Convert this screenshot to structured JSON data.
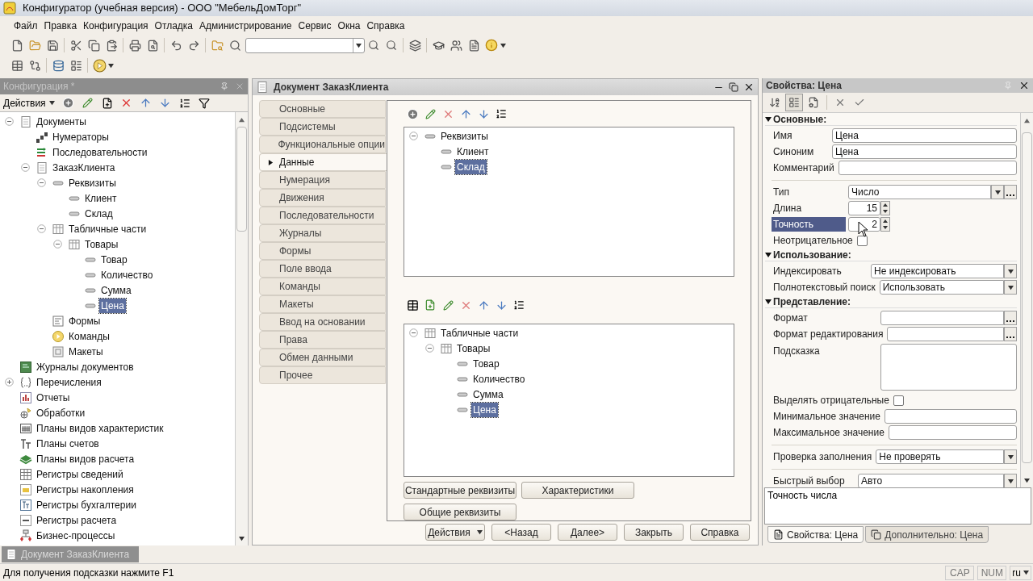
{
  "window": {
    "title": "Конфигуратор (учебная версия) - ООО \"МебельДомТорг\""
  },
  "menu": [
    "Файл",
    "Правка",
    "Конфигурация",
    "Отладка",
    "Администрирование",
    "Сервис",
    "Окна",
    "Справка"
  ],
  "config_panel": {
    "title": "Конфигурация *",
    "actions_label": "Действия",
    "tree": [
      {
        "label": "Документы",
        "kind": "documents",
        "expanded": true,
        "selected": false,
        "children": [
          {
            "label": "Нумераторы",
            "kind": "numerators",
            "selected": false
          },
          {
            "label": "Последовательности",
            "kind": "sequences",
            "selected": false
          },
          {
            "label": "ЗаказКлиента",
            "kind": "document",
            "expanded": true,
            "selected": false,
            "children": [
              {
                "label": "Реквизиты",
                "kind": "attributes",
                "expanded": true,
                "selected": false,
                "children": [
                  {
                    "label": "Клиент",
                    "kind": "attribute",
                    "selected": false
                  },
                  {
                    "label": "Склад",
                    "kind": "attribute",
                    "selected": false
                  }
                ]
              },
              {
                "label": "Табличные части",
                "kind": "tabular-sections",
                "expanded": true,
                "selected": false,
                "children": [
                  {
                    "label": "Товары",
                    "kind": "tabular-section",
                    "expanded": true,
                    "selected": false,
                    "children": [
                      {
                        "label": "Товар",
                        "kind": "attribute",
                        "selected": false
                      },
                      {
                        "label": "Количество",
                        "kind": "attribute",
                        "selected": false
                      },
                      {
                        "label": "Сумма",
                        "kind": "attribute",
                        "selected": false
                      },
                      {
                        "label": "Цена",
                        "kind": "attribute",
                        "selected": true
                      }
                    ]
                  }
                ]
              },
              {
                "label": "Формы",
                "kind": "forms",
                "selected": false
              },
              {
                "label": "Команды",
                "kind": "commands",
                "selected": false
              },
              {
                "label": "Макеты",
                "kind": "templates",
                "selected": false
              }
            ]
          }
        ]
      },
      {
        "label": "Журналы документов",
        "kind": "journals",
        "selected": false
      },
      {
        "label": "Перечисления",
        "kind": "enums",
        "expanded": false,
        "selected": false
      },
      {
        "label": "Отчеты",
        "kind": "reports",
        "selected": false
      },
      {
        "label": "Обработки",
        "kind": "processings",
        "selected": false
      },
      {
        "label": "Планы видов характеристик",
        "kind": "characteristic-plans",
        "selected": false
      },
      {
        "label": "Планы счетов",
        "kind": "account-plans",
        "selected": false
      },
      {
        "label": "Планы видов расчета",
        "kind": "calc-plans",
        "selected": false
      },
      {
        "label": "Регистры сведений",
        "kind": "info-registers",
        "selected": false
      },
      {
        "label": "Регистры накопления",
        "kind": "accum-registers",
        "selected": false
      },
      {
        "label": "Регистры бухгалтерии",
        "kind": "account-registers",
        "selected": false
      },
      {
        "label": "Регистры расчета",
        "kind": "calc-registers",
        "selected": false
      },
      {
        "label": "Бизнес-процессы",
        "kind": "business-processes",
        "selected": false
      }
    ]
  },
  "document_window": {
    "title": "Документ ЗаказКлиента",
    "tabs": [
      {
        "label": "Основные",
        "selected": false
      },
      {
        "label": "Подсистемы",
        "selected": false
      },
      {
        "label": "Функциональные опции",
        "selected": false
      },
      {
        "label": "Данные",
        "selected": true
      },
      {
        "label": "Нумерация",
        "selected": false
      },
      {
        "label": "Движения",
        "selected": false
      },
      {
        "label": "Последовательности",
        "selected": false
      },
      {
        "label": "Журналы",
        "selected": false
      },
      {
        "label": "Формы",
        "selected": false
      },
      {
        "label": "Поле ввода",
        "selected": false
      },
      {
        "label": "Команды",
        "selected": false
      },
      {
        "label": "Макеты",
        "selected": false
      },
      {
        "label": "Ввод на основании",
        "selected": false
      },
      {
        "label": "Права",
        "selected": false
      },
      {
        "label": "Обмен данными",
        "selected": false
      },
      {
        "label": "Прочее",
        "selected": false
      }
    ],
    "attributes_tree": [
      {
        "label": "Реквизиты",
        "kind": "attributes",
        "expanded": true,
        "selected": false,
        "children": [
          {
            "label": "Клиент",
            "kind": "attribute",
            "selected": false
          },
          {
            "label": "Склад",
            "kind": "attribute",
            "selected": true
          }
        ]
      }
    ],
    "tabular_tree": [
      {
        "label": "Табличные части",
        "kind": "tabular-sections",
        "expanded": true,
        "selected": false,
        "children": [
          {
            "label": "Товары",
            "kind": "tabular-section",
            "expanded": true,
            "selected": false,
            "children": [
              {
                "label": "Товар",
                "kind": "attribute",
                "selected": false
              },
              {
                "label": "Количество",
                "kind": "attribute",
                "selected": false
              },
              {
                "label": "Сумма",
                "kind": "attribute",
                "selected": false
              },
              {
                "label": "Цена",
                "kind": "attribute",
                "selected": true
              }
            ]
          }
        ]
      }
    ],
    "side_buttons": [
      "Стандартные реквизиты",
      "Характеристики",
      "Общие реквизиты"
    ],
    "footer_buttons": [
      {
        "label": "Действия",
        "kind": "menu"
      },
      {
        "label": "<Назад",
        "kind": "plain"
      },
      {
        "label": "Далее>",
        "kind": "plain"
      },
      {
        "label": "Закрыть",
        "kind": "plain"
      },
      {
        "label": "Справка",
        "kind": "plain"
      }
    ]
  },
  "properties": {
    "title": "Свойства: Цена",
    "sections": [
      {
        "title": "Основные:",
        "expanded": true,
        "rows": [
          {
            "kind": "text",
            "label": "Имя",
            "value": "Цена",
            "selected": false
          },
          {
            "kind": "text",
            "label": "Синоним",
            "value": "Цена",
            "selected": false
          },
          {
            "kind": "text",
            "label": "Комментарий",
            "selected": false
          },
          {
            "kind": "separator"
          },
          {
            "kind": "select-more",
            "label": "Тип",
            "value": "Число",
            "selected": false
          },
          {
            "kind": "spin",
            "label": "Длина",
            "value": "15",
            "selected": false
          },
          {
            "kind": "spin",
            "label": "Точность",
            "value": "2",
            "selected": true
          },
          {
            "kind": "checkbox",
            "label": "Неотрицательное",
            "checked": false,
            "selected": false
          }
        ]
      },
      {
        "title": "Использование:",
        "expanded": true,
        "rows": [
          {
            "kind": "select",
            "label": "Индексировать",
            "value": "Не индексировать",
            "selected": false
          },
          {
            "kind": "select",
            "label": "Полнотекстовый поиск",
            "value": "Использовать",
            "selected": false
          }
        ]
      },
      {
        "title": "Представление:",
        "expanded": true,
        "rows": [
          {
            "kind": "more",
            "label": "Формат",
            "selected": false
          },
          {
            "kind": "more",
            "label": "Формат редактирования",
            "selected": false
          },
          {
            "kind": "memo",
            "label": "Подсказка",
            "selected": false
          },
          {
            "kind": "checkbox",
            "label": "Выделять отрицательные",
            "checked": false,
            "selected": false
          },
          {
            "kind": "text",
            "label": "Минимальное значение",
            "selected": false
          },
          {
            "kind": "text",
            "label": "Максимальное значение",
            "selected": false
          },
          {
            "kind": "separator"
          },
          {
            "kind": "select",
            "label": "Проверка заполнения",
            "value": "Не проверять",
            "selected": false
          },
          {
            "kind": "separator"
          },
          {
            "kind": "select",
            "label": "Быстрый выбор",
            "value": "Авто",
            "selected": false
          }
        ]
      }
    ],
    "description": "Точность числа",
    "tabs": [
      {
        "label": "Свойства: Цена",
        "selected": true
      },
      {
        "label": "Дополнительно: Цена",
        "selected": false
      }
    ]
  },
  "taskbar": [
    {
      "label": "Документ ЗаказКлиента"
    }
  ],
  "status_bar": {
    "hint": "Для получения подсказки нажмите F1",
    "indicators": [
      "CAP",
      "NUM"
    ],
    "language": "ru"
  }
}
